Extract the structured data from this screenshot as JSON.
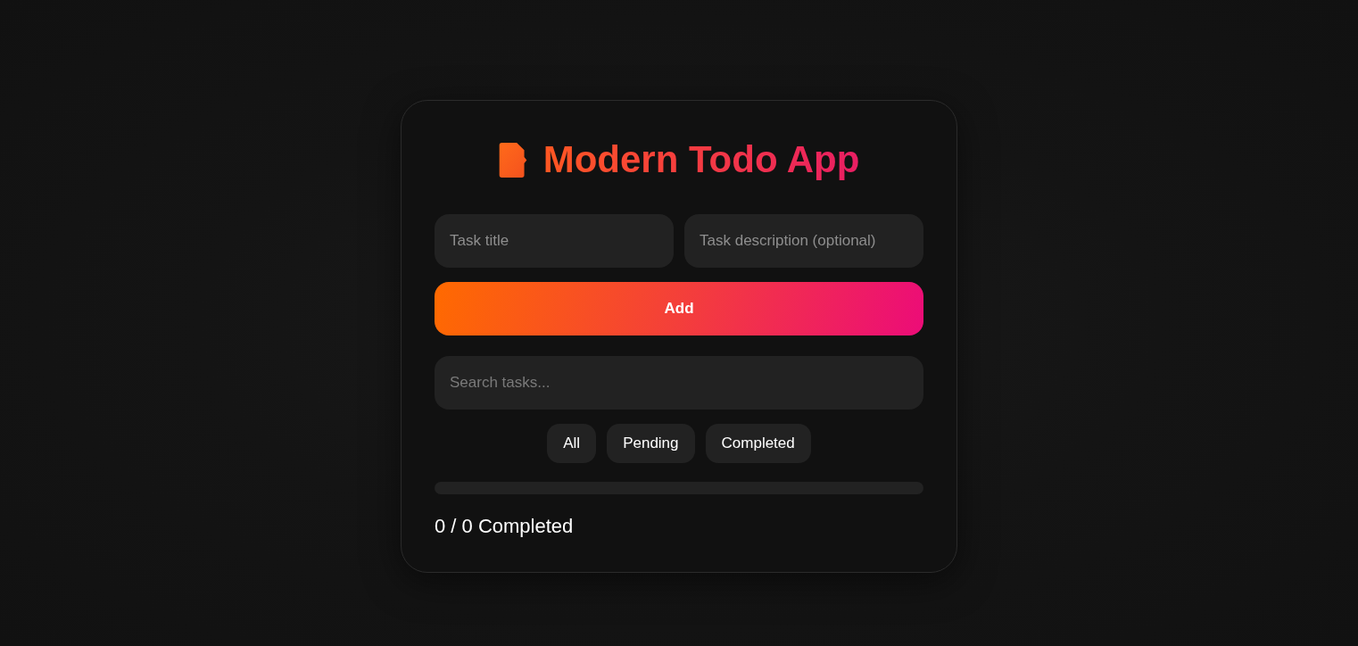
{
  "header": {
    "title": "Modern Todo App"
  },
  "form": {
    "title_field": {
      "placeholder": "Task title"
    },
    "description_field": {
      "placeholder": "Task description (optional)"
    },
    "add_button": "Add"
  },
  "search": {
    "placeholder": "Search tasks..."
  },
  "filters": [
    {
      "label": "All",
      "selected": false
    },
    {
      "label": "Pending",
      "selected": false
    },
    {
      "label": "Completed",
      "selected": false
    }
  ],
  "progress": {
    "level": 0
  },
  "status": "0 / 0 Completed"
}
